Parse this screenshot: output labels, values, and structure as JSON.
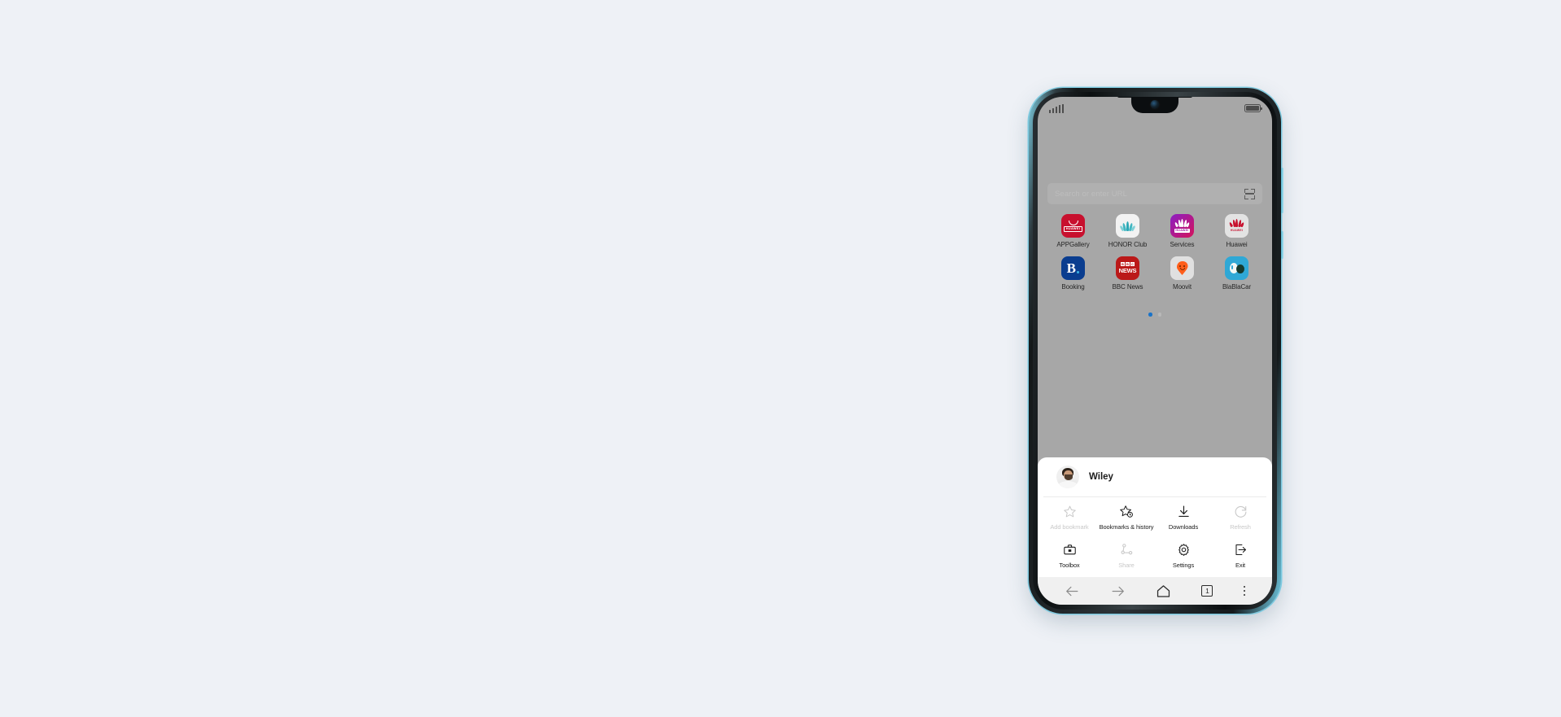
{
  "page": {
    "background_color": "#eef1f6"
  },
  "device": {
    "frame_accent_color": "#6fc9e2",
    "screen_dim_color": "#a7a7a7"
  },
  "status_bar": {
    "signal_icon": "signal-bars-icon",
    "battery_icon": "battery-full-icon"
  },
  "browser": {
    "search": {
      "placeholder": "Search or enter URL",
      "scan_icon": "scan-qr-icon"
    },
    "shortcuts": [
      {
        "label": "APPGallery",
        "icon": "appgallery-icon",
        "wordmark": "HUAWEI"
      },
      {
        "label": "HONOR Club",
        "icon": "honor-club-icon",
        "wordmark": ""
      },
      {
        "label": "Services",
        "icon": "huawei-services-icon",
        "wordmark": "HUAWEI"
      },
      {
        "label": "Huawei",
        "icon": "huawei-icon",
        "wordmark": "HUAWEI"
      },
      {
        "label": "Booking",
        "icon": "booking-icon",
        "wordmark": "B"
      },
      {
        "label": "BBC News",
        "icon": "bbc-news-icon",
        "wordmark": "NEWS"
      },
      {
        "label": "Moovit",
        "icon": "moovit-icon",
        "wordmark": ""
      },
      {
        "label": "BlaBlaCar",
        "icon": "blablacar-icon",
        "wordmark": ""
      }
    ],
    "pagination": {
      "total": 2,
      "active_index": 0,
      "active_color": "#1a73c9"
    }
  },
  "bottom_sheet": {
    "profile": {
      "name": "Wiley",
      "avatar_icon": "user-avatar"
    },
    "menu_rows": [
      [
        {
          "label": "Add bookmark",
          "icon": "star-outline-icon",
          "disabled": true
        },
        {
          "label": "Bookmarks & history",
          "icon": "star-clock-icon",
          "disabled": false
        },
        {
          "label": "Downloads",
          "icon": "download-arrow-icon",
          "disabled": false
        },
        {
          "label": "Refresh",
          "icon": "refresh-circle-icon",
          "disabled": true
        }
      ],
      [
        {
          "label": "Toolbox",
          "icon": "toolbox-icon",
          "disabled": false
        },
        {
          "label": "Share",
          "icon": "share-nodes-icon",
          "disabled": true
        },
        {
          "label": "Settings",
          "icon": "gear-icon",
          "disabled": false
        },
        {
          "label": "Exit",
          "icon": "exit-arrow-icon",
          "disabled": false
        }
      ]
    ]
  },
  "nav_bar": {
    "back_icon": "arrow-left-icon",
    "forward_icon": "arrow-right-icon",
    "home_icon": "home-icon",
    "tabs_count": "1",
    "more_icon": "more-vertical-icon"
  }
}
